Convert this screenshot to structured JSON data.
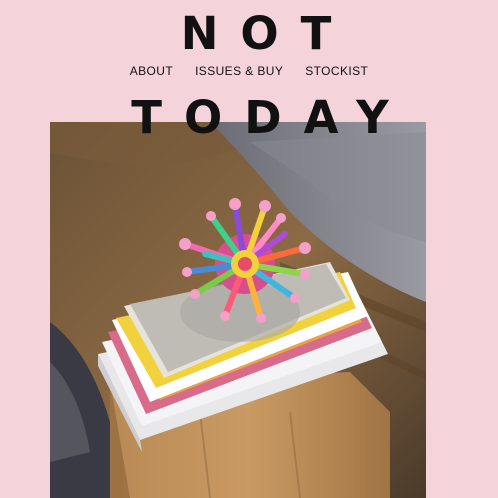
{
  "brand": {
    "line1": "NOT",
    "line2": "TODAY"
  },
  "nav": {
    "items": [
      {
        "label": "ABOUT"
      },
      {
        "label": "ISSUES & BUY"
      },
      {
        "label": "STOCKIST"
      }
    ]
  },
  "hero": {
    "subject": "stack-of-magazines-with-flower-sculpture"
  }
}
